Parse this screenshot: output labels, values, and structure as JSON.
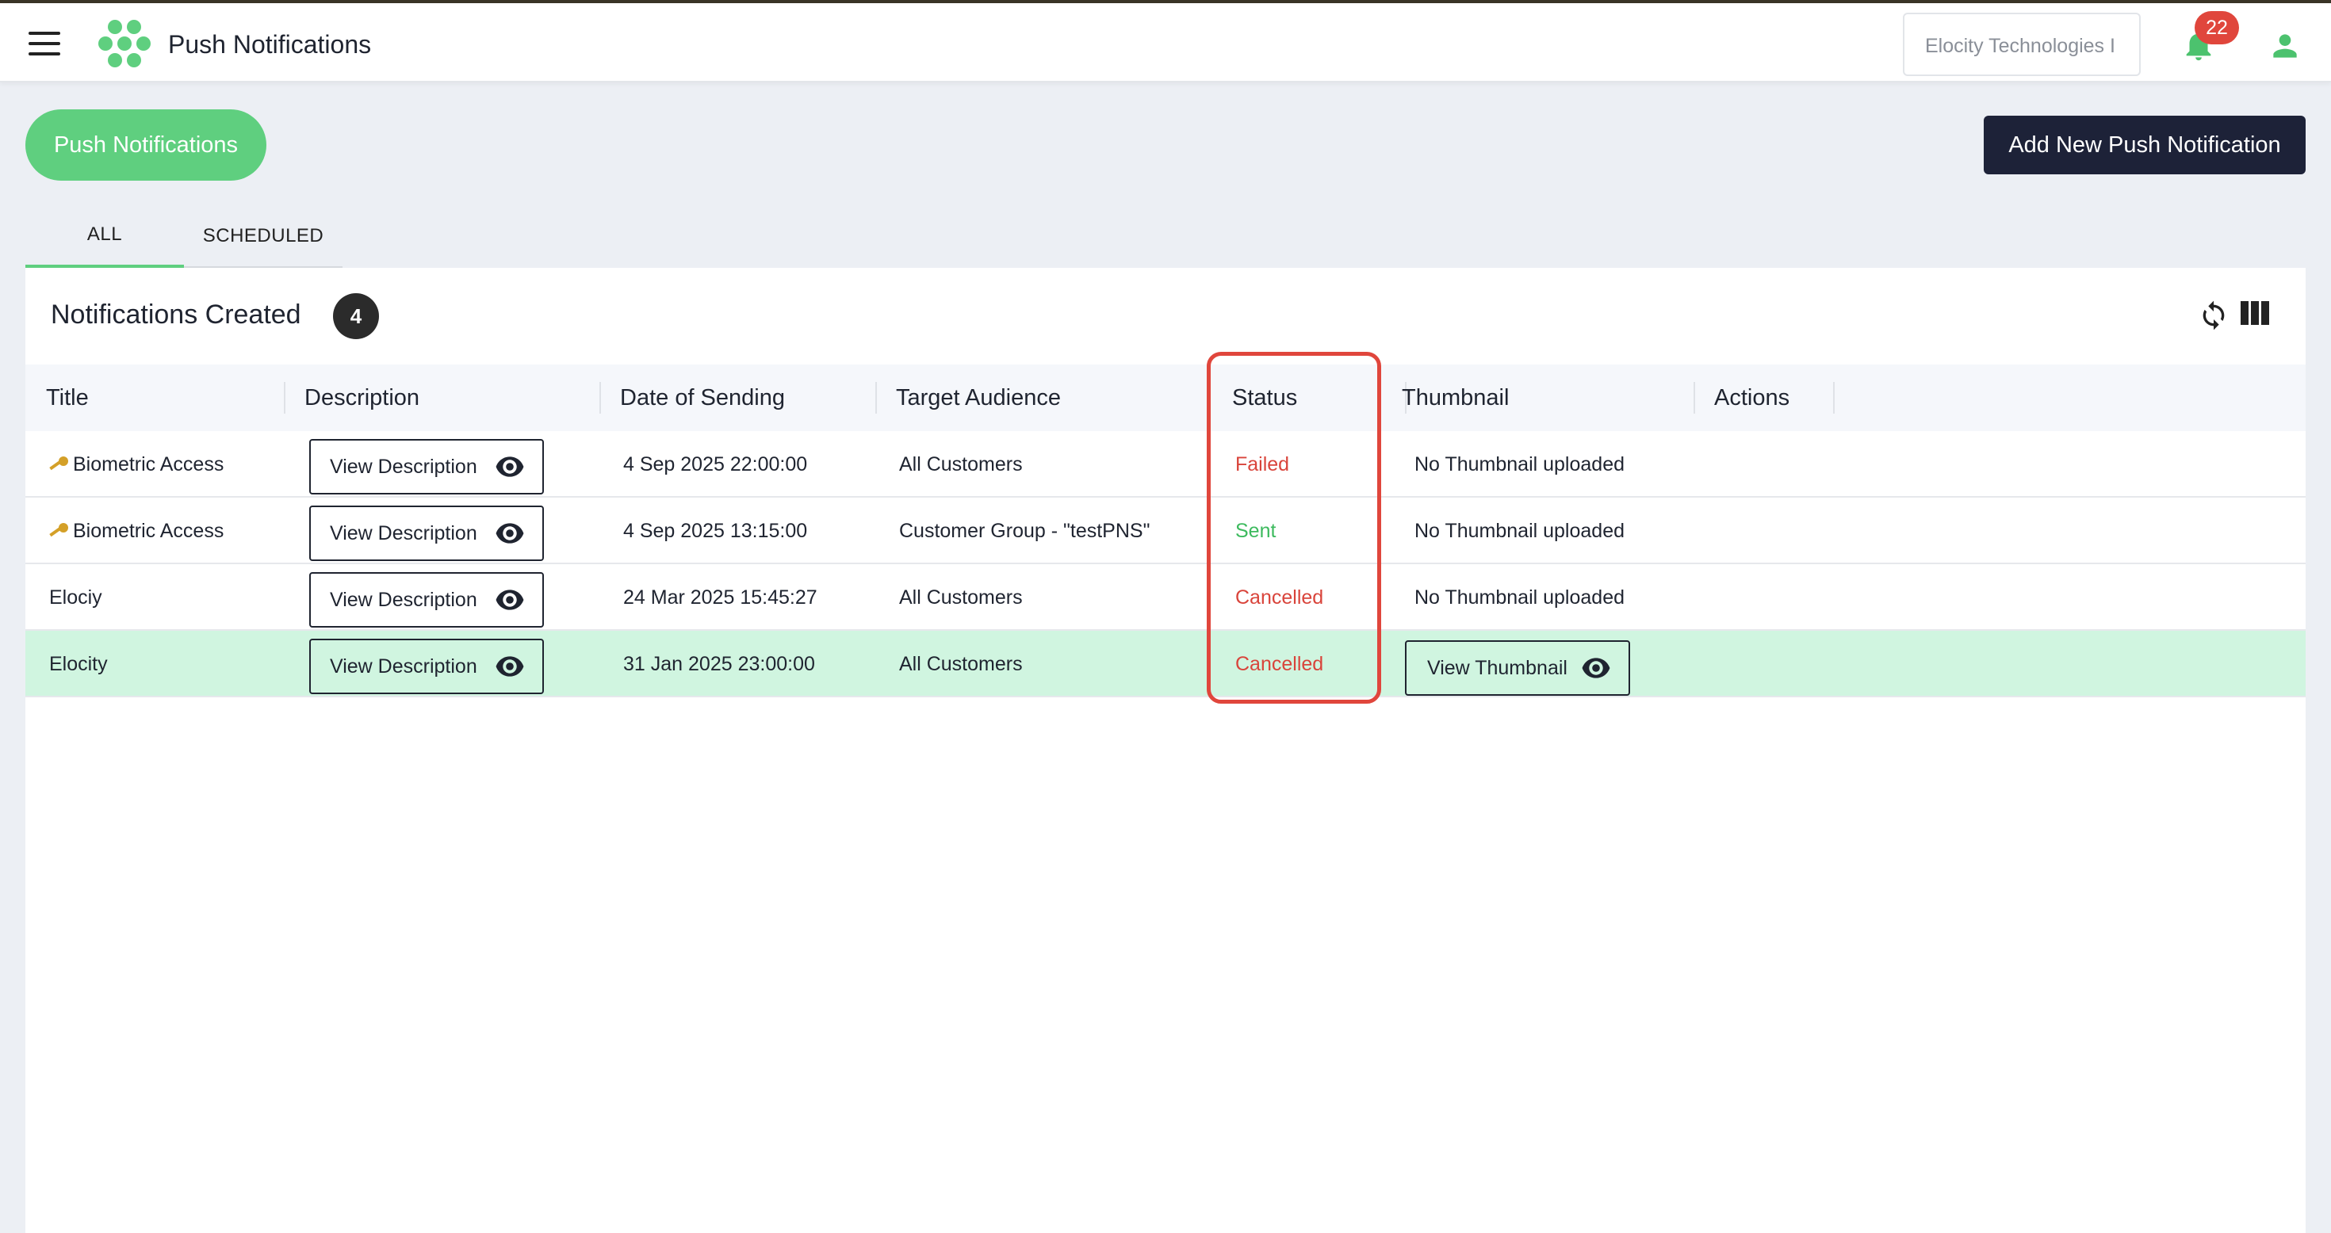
{
  "header": {
    "title": "Push Notifications",
    "org_selector": "Elocity Technologies I",
    "notifications_count": "22"
  },
  "page": {
    "pill_label": "Push Notifications",
    "add_button": "Add New Push Notification"
  },
  "tabs": [
    {
      "label": "ALL",
      "active": true
    },
    {
      "label": "SCHEDULED",
      "active": false
    }
  ],
  "card": {
    "title": "Notifications Created",
    "count": "4"
  },
  "table": {
    "columns": [
      "Title",
      "Description",
      "Date of Sending",
      "Target Audience",
      "Status",
      "Thumbnail",
      "Actions"
    ],
    "rows": [
      {
        "title": "Biometric Access",
        "has_key_icon": true,
        "description": "View Description",
        "date": "4 Sep 2025 22:00:00",
        "audience": "All Customers",
        "status": "Failed",
        "thumbnail": "No Thumbnail uploaded"
      },
      {
        "title": "Biometric Access",
        "has_key_icon": true,
        "description": "View Description",
        "date": "4 Sep 2025 13:15:00",
        "audience": "Customer Group - \"testPNS\"",
        "status": "Sent",
        "thumbnail": "No Thumbnail uploaded"
      },
      {
        "title": "Elociy",
        "has_key_icon": false,
        "description": "View Description",
        "date": "24 Mar 2025 15:45:27",
        "audience": "All Customers",
        "status": "Cancelled",
        "thumbnail": "No Thumbnail uploaded"
      },
      {
        "title": "Elocity",
        "has_key_icon": false,
        "description": "View Description",
        "date": "31 Jan 2025 23:00:00",
        "audience": "All Customers",
        "status": "Cancelled",
        "thumbnail": "View Thumbnail"
      }
    ]
  },
  "colors": {
    "accent_green": "#5fcf7f",
    "dark_button": "#1d2238",
    "status_failed": "#d9443b",
    "status_sent": "#3dba5e",
    "status_cancelled": "#d9443b",
    "highlight_row": "#d0f5e0",
    "annotation_red": "#e0463c"
  },
  "icons": [
    "menu-icon",
    "logo-icon",
    "bell-icon",
    "user-icon",
    "refresh-icon",
    "columns-icon",
    "eye-icon",
    "key-icon"
  ]
}
